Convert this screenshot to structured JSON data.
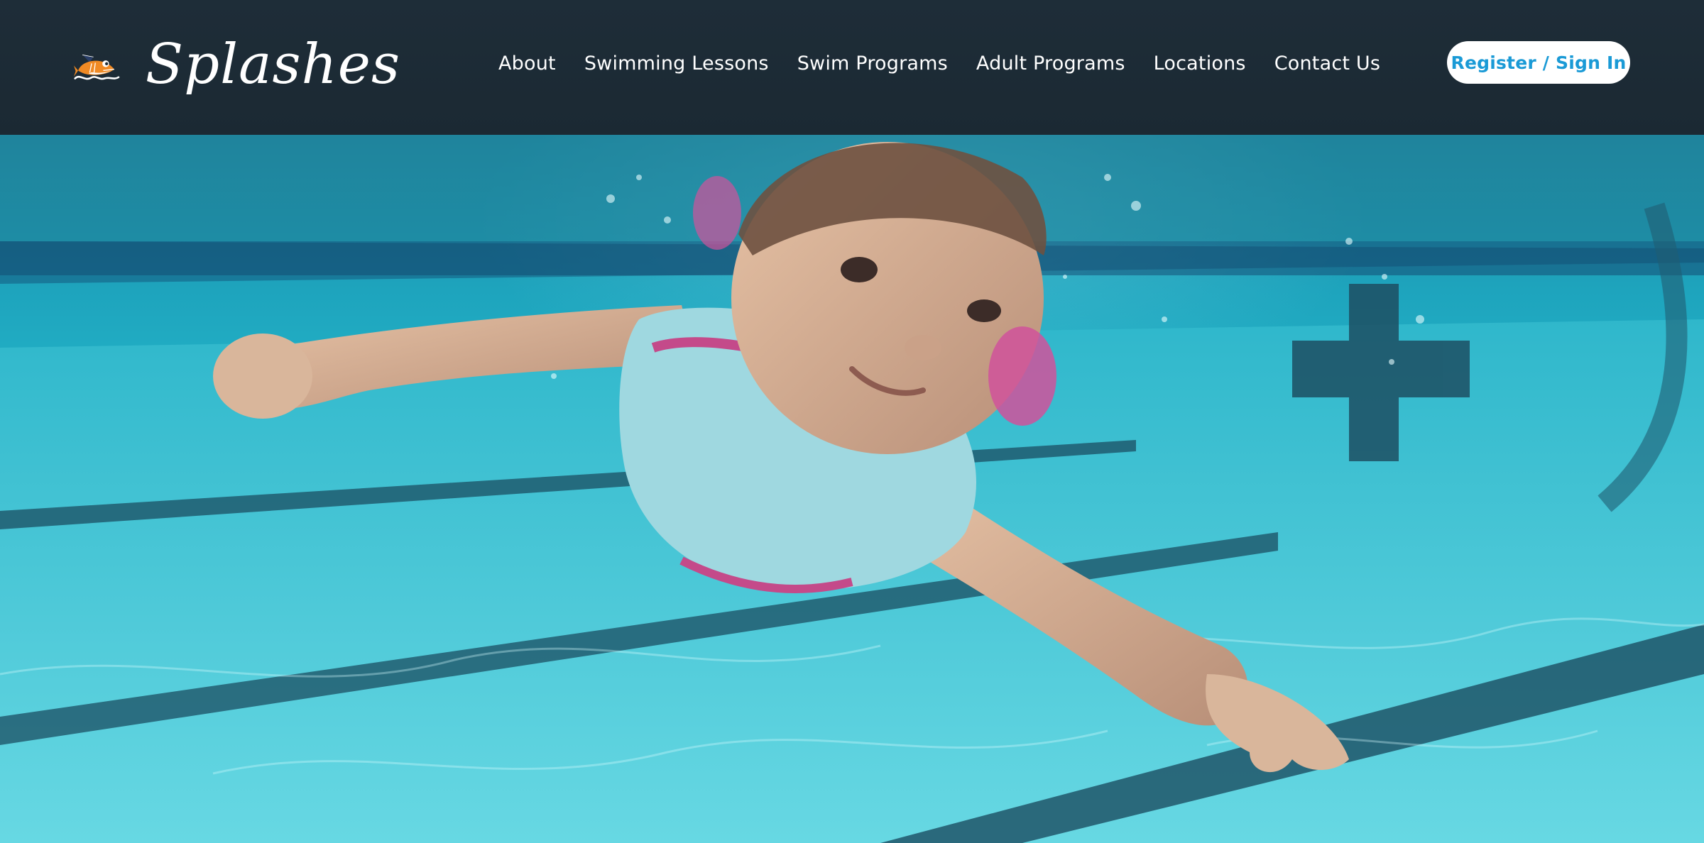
{
  "brand": {
    "name": "Splashes",
    "logo_icon": "shark-mascot-icon",
    "colors": {
      "header_bg": "#1c2b36",
      "accent": "#1a9ad6",
      "mascot_orange": "#f08a24",
      "water": "#2ab6cb"
    }
  },
  "nav": {
    "items": [
      {
        "label": "About"
      },
      {
        "label": "Swimming Lessons"
      },
      {
        "label": "Swim Programs"
      },
      {
        "label": "Adult Programs"
      },
      {
        "label": "Locations"
      },
      {
        "label": "Contact Us"
      }
    ]
  },
  "header": {
    "register_label": "Register / Sign In"
  },
  "hero": {
    "image": "baby-swimming-underwater-photo"
  }
}
